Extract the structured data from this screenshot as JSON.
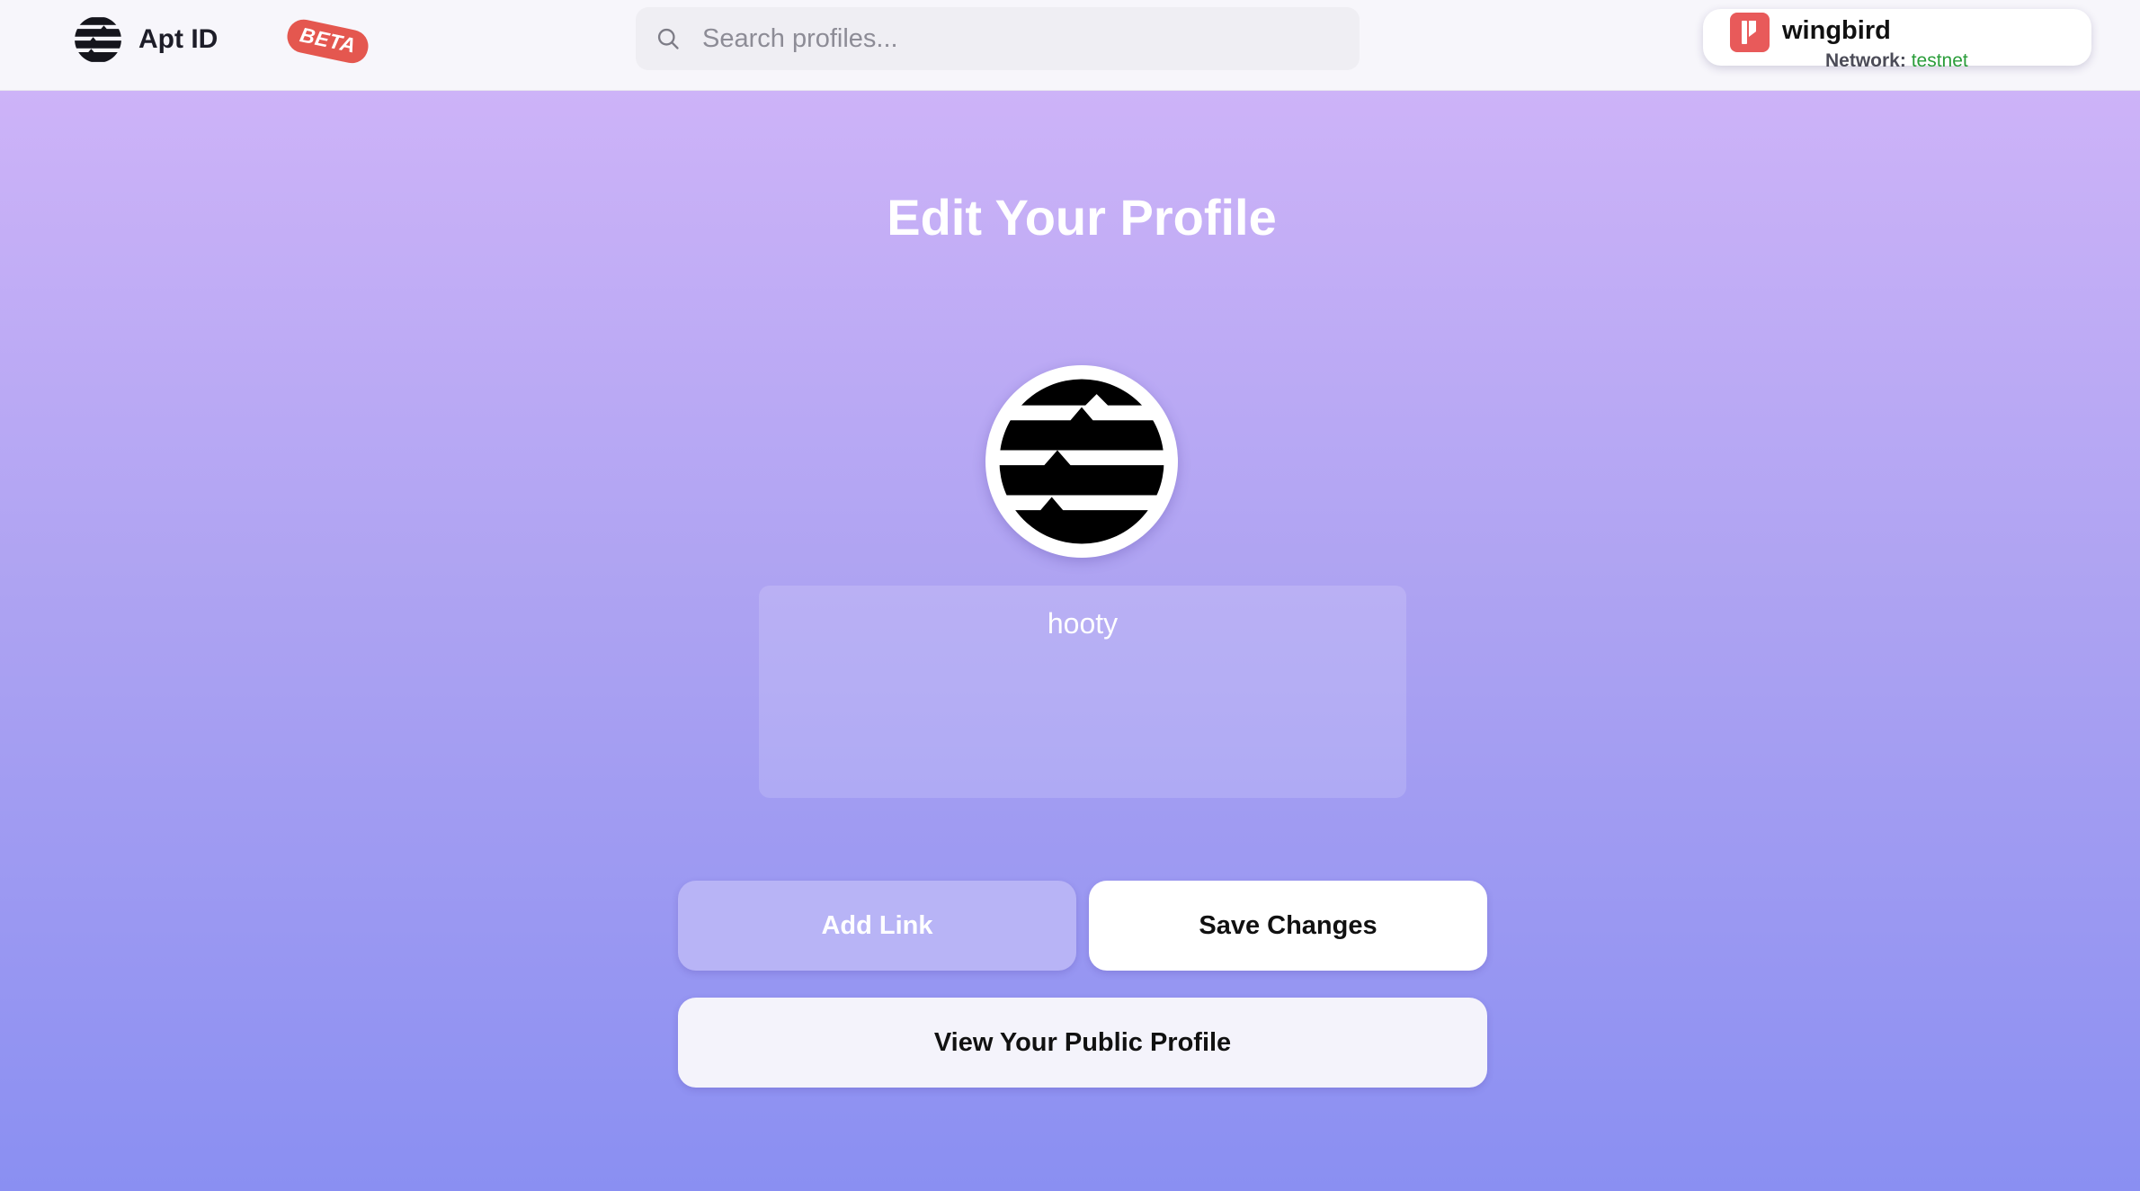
{
  "header": {
    "brand_name": "Apt ID",
    "beta_label": "BETA",
    "search": {
      "placeholder": "Search profiles...",
      "value": ""
    },
    "wallet": {
      "name": "wingbird",
      "network_label": "Network:",
      "network_value": "testnet",
      "icon": "petra-wallet-icon"
    }
  },
  "main": {
    "title": "Edit Your Profile",
    "avatar_icon": "aptos-logo",
    "bio_value": "hooty",
    "buttons": {
      "add_link": "Add Link",
      "save_changes": "Save Changes",
      "view_public_profile": "View Your Public Profile"
    }
  },
  "colors": {
    "gradient_top": "#cdb3f8",
    "gradient_bottom": "#8a8ff2",
    "beta_badge": "#e4574f",
    "network_value": "#2a9d3a",
    "wallet_icon": "#e85a5a"
  }
}
